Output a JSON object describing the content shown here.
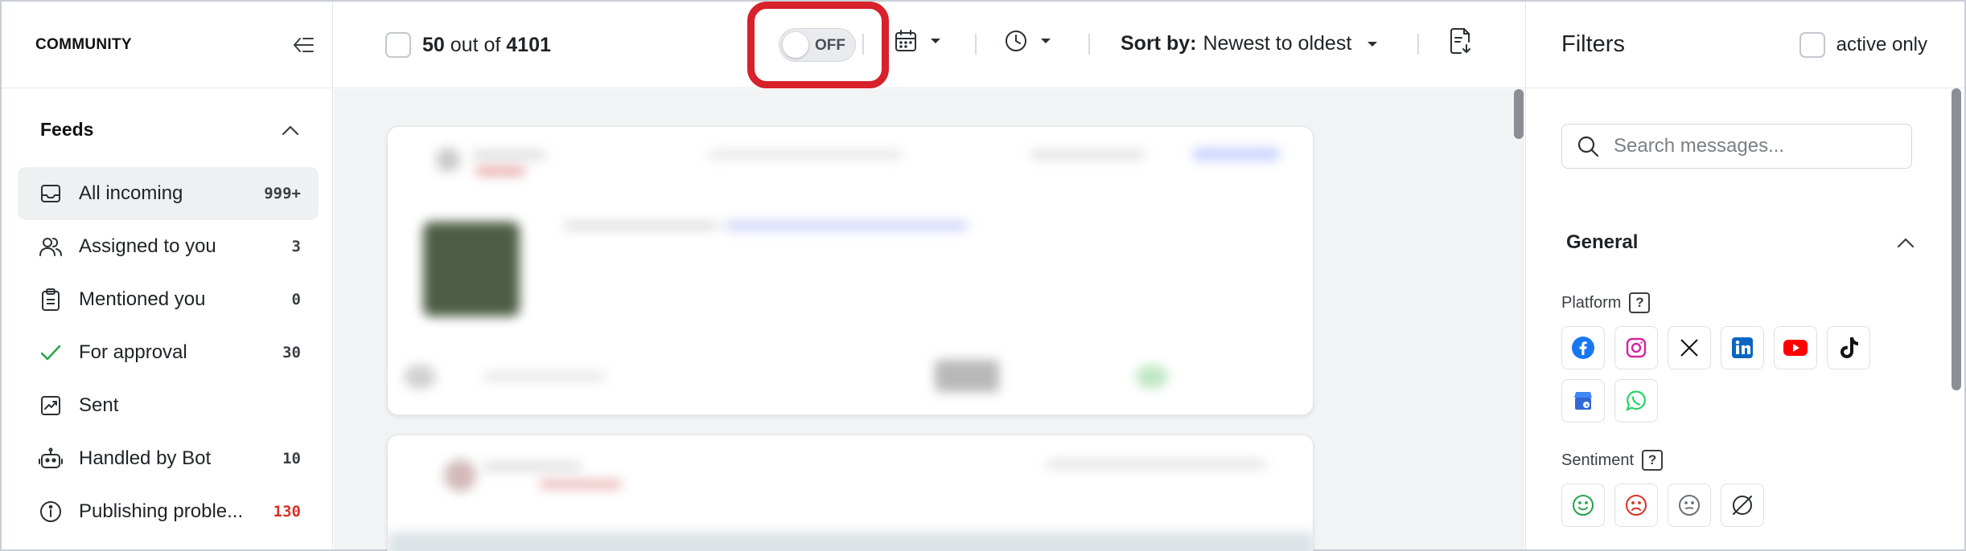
{
  "sidebar": {
    "brand": "COMMUNITY",
    "feeds_title": "Feeds",
    "items": [
      {
        "label": "All incoming",
        "count": "999+",
        "icon": "inbox-icon",
        "active": true
      },
      {
        "label": "Assigned to you",
        "count": "3",
        "icon": "users-icon"
      },
      {
        "label": "Mentioned you",
        "count": "0",
        "icon": "clipboard-icon"
      },
      {
        "label": "For approval",
        "count": "30",
        "icon": "check-icon"
      },
      {
        "label": "Sent",
        "count": "",
        "icon": "sent-chart-icon"
      },
      {
        "label": "Handled by Bot",
        "count": "10",
        "icon": "bot-icon"
      },
      {
        "label": "Publishing proble...",
        "count": "130",
        "icon": "info-icon",
        "count_color": "#d93025"
      }
    ]
  },
  "topbar": {
    "count_shown": "50",
    "count_mid": "out of",
    "count_total": "4101",
    "toggle_label": "OFF",
    "sort_prefix": "Sort by:",
    "sort_value": "Newest to oldest"
  },
  "filters": {
    "title": "Filters",
    "active_only_label": "active only",
    "search_placeholder": "Search messages...",
    "general_title": "General",
    "platform_label": "Platform",
    "sentiment_label": "Sentiment",
    "platforms": [
      "facebook-icon",
      "instagram-icon",
      "x-icon",
      "linkedin-icon",
      "youtube-icon",
      "tiktok-icon",
      "google-business-icon",
      "whatsapp-icon"
    ],
    "sentiments": [
      "positive-sentiment-icon",
      "negative-sentiment-icon",
      "neutral-sentiment-icon",
      "no-sentiment-icon"
    ]
  },
  "colors": {
    "highlight": "#d7212b",
    "approval_check": "#22a447",
    "error_count": "#d93025"
  }
}
